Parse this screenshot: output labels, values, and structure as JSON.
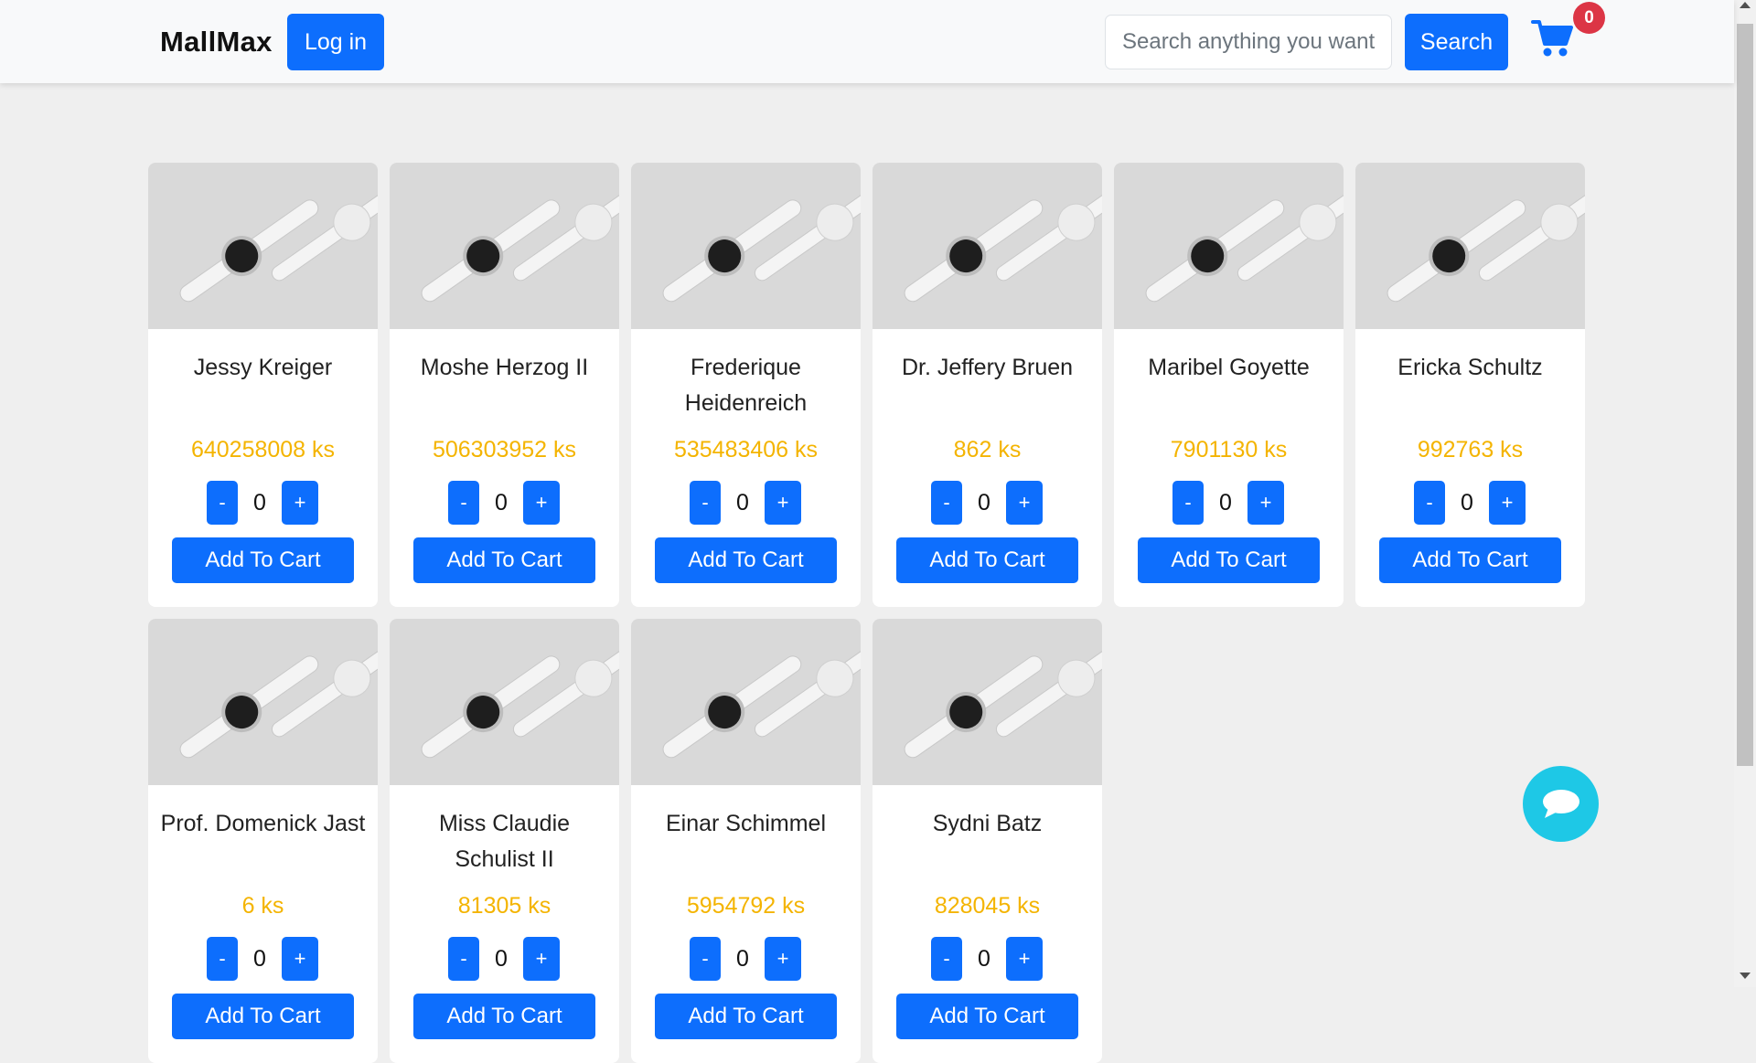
{
  "header": {
    "brand": "MallMax",
    "login_label": "Log in",
    "search_placeholder": "Search anything you want",
    "search_label": "Search",
    "cart_count": "0"
  },
  "currency_suffix": "ks",
  "products": [
    {
      "name": "Jessy Kreiger",
      "price": "640258008 ks",
      "qty": "0",
      "minus": "-",
      "plus": "+",
      "add_label": "Add To Cart"
    },
    {
      "name": "Moshe Herzog II",
      "price": "506303952 ks",
      "qty": "0",
      "minus": "-",
      "plus": "+",
      "add_label": "Add To Cart"
    },
    {
      "name": "Frederique Heidenreich",
      "price": "535483406 ks",
      "qty": "0",
      "minus": "-",
      "plus": "+",
      "add_label": "Add To Cart"
    },
    {
      "name": "Dr. Jeffery Bruen",
      "price": "862 ks",
      "qty": "0",
      "minus": "-",
      "plus": "+",
      "add_label": "Add To Cart"
    },
    {
      "name": "Maribel Goyette",
      "price": "7901130 ks",
      "qty": "0",
      "minus": "-",
      "plus": "+",
      "add_label": "Add To Cart"
    },
    {
      "name": "Ericka Schultz",
      "price": "992763 ks",
      "qty": "0",
      "minus": "-",
      "plus": "+",
      "add_label": "Add To Cart"
    },
    {
      "name": "Prof. Domenick Jast",
      "price": "6 ks",
      "qty": "0",
      "minus": "-",
      "plus": "+",
      "add_label": "Add To Cart"
    },
    {
      "name": "Miss Claudie Schulist II",
      "price": "81305 ks",
      "qty": "0",
      "minus": "-",
      "plus": "+",
      "add_label": "Add To Cart"
    },
    {
      "name": "Einar Schimmel",
      "price": "5954792 ks",
      "qty": "0",
      "minus": "-",
      "plus": "+",
      "add_label": "Add To Cart"
    },
    {
      "name": "Sydni Batz",
      "price": "828045 ks",
      "qty": "0",
      "minus": "-",
      "plus": "+",
      "add_label": "Add To Cart"
    }
  ],
  "colors": {
    "primary": "#0d6efd",
    "price": "#f4b400",
    "badge": "#dc3545",
    "chat": "#1ec8e6",
    "background": "#efefef"
  },
  "icons": {
    "cart": "shopping-cart-icon",
    "chat": "chat-bubble-icon",
    "product_image": "smartwatch-product-image"
  }
}
